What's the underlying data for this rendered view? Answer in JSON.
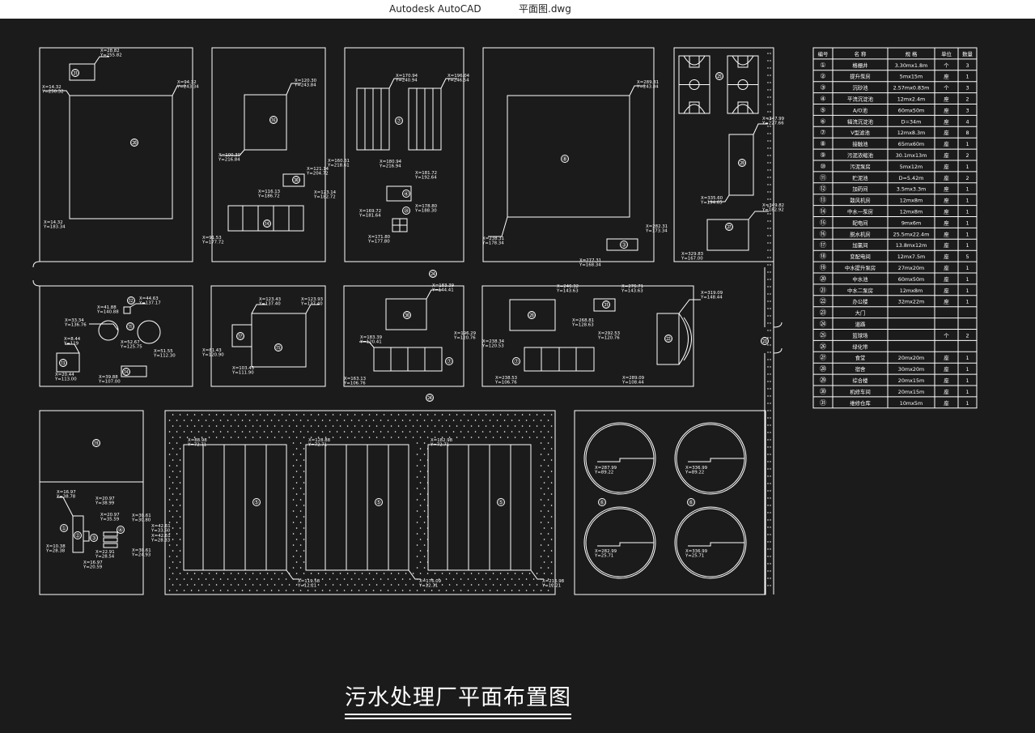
{
  "window": {
    "app_name": "Autodesk AutoCAD",
    "file_name": "平面图.dwg"
  },
  "drawing": {
    "title": "污水处理厂平面布置图",
    "line_color": "#ffffff",
    "background_color": "#1b1b1b",
    "titlebar_color": "#ffffff",
    "structure_labels": [
      "①",
      "②",
      "③",
      "④",
      "⑤",
      "⑥",
      "⑦",
      "⑧",
      "⑨",
      "⑩",
      "⑪",
      "⑫",
      "⑬",
      "⑭",
      "⑮",
      "⑯",
      "⑰",
      "⑱",
      "⑲",
      "⑳",
      "㉑",
      "㉒",
      "㉓",
      "㉔",
      "㉕",
      "㉖",
      "㉗",
      "㉘",
      "㉙",
      "㉚",
      "㉛"
    ]
  },
  "legend_table": {
    "headers": [
      "编号",
      "名 称",
      "规 格",
      "单位",
      "数量"
    ],
    "rows": [
      [
        "①",
        "格栅井",
        "3.30mx1.8m",
        "个",
        "3"
      ],
      [
        "②",
        "提升泵房",
        "5mx15m",
        "座",
        "1"
      ],
      [
        "③",
        "沉砂池",
        "2.57mx0.83m",
        "个",
        "3"
      ],
      [
        "④",
        "平流沉淀池",
        "12mx2.4m",
        "座",
        "2"
      ],
      [
        "⑤",
        "A/O池",
        "60mx50m",
        "座",
        "3"
      ],
      [
        "⑥",
        "辐流沉淀池",
        "D=34m",
        "座",
        "4"
      ],
      [
        "⑦",
        "V型滤池",
        "12mx8.3m",
        "座",
        "8"
      ],
      [
        "⑧",
        "接触池",
        "65mx60m",
        "座",
        "1"
      ],
      [
        "⑨",
        "污泥浓缩池",
        "30.1mx13m",
        "座",
        "2"
      ],
      [
        "⑩",
        "污泥泵房",
        "5mx12m",
        "座",
        "1"
      ],
      [
        "⑪",
        "贮泥池",
        "D=5.42m",
        "座",
        "2"
      ],
      [
        "⑫",
        "加药间",
        "3.5mx3.3m",
        "座",
        "1"
      ],
      [
        "⑬",
        "鼓风机房",
        "12mx8m",
        "座",
        "1"
      ],
      [
        "⑭",
        "中水一泵房",
        "12mx8m",
        "座",
        "1"
      ],
      [
        "⑮",
        "配电间",
        "9mx6m",
        "座",
        "1"
      ],
      [
        "⑯",
        "脱水机房",
        "25.5mx22.4m",
        "座",
        "1"
      ],
      [
        "⑰",
        "加氯间",
        "13.8mx12m",
        "座",
        "1"
      ],
      [
        "⑱",
        "变配电间",
        "12mx7.5m",
        "座",
        "5"
      ],
      [
        "⑲",
        "中水提升泵房",
        "27mx20m",
        "座",
        "1"
      ],
      [
        "⑳",
        "中水池",
        "60mx50m",
        "座",
        "1"
      ],
      [
        "㉑",
        "中水二泵房",
        "12mx8m",
        "座",
        "1"
      ],
      [
        "㉒",
        "办公楼",
        "32mx22m",
        "座",
        "1"
      ],
      [
        "㉓",
        "大门",
        "",
        "",
        ""
      ],
      [
        "㉔",
        "道路",
        "",
        "",
        ""
      ],
      [
        "㉕",
        "篮球场",
        "",
        "个",
        "2"
      ],
      [
        "㉖",
        "绿化带",
        "",
        "",
        ""
      ],
      [
        "㉗",
        "食堂",
        "20mx20m",
        "座",
        "1"
      ],
      [
        "㉘",
        "宿舍",
        "30mx20m",
        "座",
        "1"
      ],
      [
        "㉙",
        "综合楼",
        "20mx15m",
        "座",
        "1"
      ],
      [
        "㉚",
        "机修车间",
        "20mx15m",
        "座",
        "1"
      ],
      [
        "㉛",
        "维修仓库",
        "10mx5m",
        "座",
        "1"
      ]
    ]
  },
  "coordinate_labels": [
    {
      "x": "X=28.82",
      "y": "Y=255.82"
    },
    {
      "x": "X=14.32",
      "y": "Y=250.32"
    },
    {
      "x": "X=94.32",
      "y": "Y=243.34"
    },
    {
      "x": "X=14.32",
      "y": "Y=183.34"
    },
    {
      "x": "X=120.30",
      "y": "Y=243.84"
    },
    {
      "x": "X=100.30",
      "y": "Y=216.84"
    },
    {
      "x": "X=121.14",
      "y": "Y=204.72"
    },
    {
      "x": "X=116.13",
      "y": "Y=186.72"
    },
    {
      "x": "X=123.14",
      "y": "Y=182.72"
    },
    {
      "x": "X=91.53",
      "y": "Y=177.72"
    },
    {
      "x": "X=170.94",
      "y": "Y=240.94"
    },
    {
      "x": "X=196.04",
      "y": "Y=246.54"
    },
    {
      "x": "X=160.61",
      "y": "Y=218.61"
    },
    {
      "x": "X=180.94",
      "y": "Y=216.94"
    },
    {
      "x": "X=181.72",
      "y": "Y=192.64"
    },
    {
      "x": "X=169.72",
      "y": "Y=181.64"
    },
    {
      "x": "X=178.80",
      "y": "Y=188.30"
    },
    {
      "x": "X=171.80",
      "y": "Y=177.80"
    },
    {
      "x": "X=289.31",
      "y": "Y=243.84"
    },
    {
      "x": "X=238.31",
      "y": "Y=178.34"
    },
    {
      "x": "X=282.31",
      "y": "Y=173.34"
    },
    {
      "x": "X=277.31",
      "y": "Y=168.34"
    },
    {
      "x": "X=347.99",
      "y": "Y=227.66"
    },
    {
      "x": "X=335.60",
      "y": "Y=194.65"
    },
    {
      "x": "X=349.82",
      "y": "Y=182.92"
    },
    {
      "x": "X=329.83",
      "y": "Y=167.00"
    },
    {
      "x": "X=44.63",
      "y": "Y=137.17"
    },
    {
      "x": "X=41.88",
      "y": "Y=140.88"
    },
    {
      "x": "X=33.34",
      "y": "Y=136.76"
    },
    {
      "x": "X=8.44",
      "y": "Y=119"
    },
    {
      "x": "X=52.67",
      "y": "Y=125.75"
    },
    {
      "x": "X=51.55",
      "y": "Y=112.30"
    },
    {
      "x": "X=20.44",
      "y": "Y=113.00"
    },
    {
      "x": "X=39.88",
      "y": "Y=107.00"
    },
    {
      "x": "X=123.43",
      "y": "Y=137.40"
    },
    {
      "x": "X=123.93",
      "y": "Y=137.40"
    },
    {
      "x": "X=81.43",
      "y": "Y=120.90"
    },
    {
      "x": "X=103.43",
      "y": "Y=111.90"
    },
    {
      "x": "X=183.39",
      "y": "Y=144.41"
    },
    {
      "x": "X=183.39",
      "y": "Y=120.41"
    },
    {
      "x": "X=196.29",
      "y": "Y=120.76"
    },
    {
      "x": "X=163.13",
      "y": "Y=106.76"
    },
    {
      "x": "X=246.32",
      "y": "Y=143.63"
    },
    {
      "x": "X=276.71",
      "y": "Y=143.63"
    },
    {
      "x": "X=268.81",
      "y": "Y=128.63"
    },
    {
      "x": "X=292.53",
      "y": "Y=120.76"
    },
    {
      "x": "X=238.34",
      "y": "Y=120.53"
    },
    {
      "x": "X=238.53",
      "y": "Y=106.76"
    },
    {
      "x": "X=289.09",
      "y": "Y=108.44"
    },
    {
      "x": "X=319.09",
      "y": "Y=148.44"
    },
    {
      "x": "X=88.98",
      "y": "Y=72.71"
    },
    {
      "x": "X=128.88",
      "y": "Y=72.71"
    },
    {
      "x": "X=182.98",
      "y": "Y=72.71"
    },
    {
      "x": "X=119.58",
      "y": "Y=12.21"
    },
    {
      "x": "X=176.09",
      "y": "Y=12.31"
    },
    {
      "x": "X=216.98",
      "y": "Y=12.21"
    },
    {
      "x": "X=287.99",
      "y": "Y=89.22"
    },
    {
      "x": "X=336.99",
      "y": "Y=89.22"
    },
    {
      "x": "X=282.99",
      "y": "Y=25.71"
    },
    {
      "x": "X=336.99",
      "y": "Y=25.71"
    },
    {
      "x": "X=16.97",
      "y": "Y=38.78"
    },
    {
      "x": "X=20.97",
      "y": "Y=38.99"
    },
    {
      "x": "X=20.97",
      "y": "Y=35.59"
    },
    {
      "x": "X=30.61",
      "y": "Y=30.80"
    },
    {
      "x": "X=42.61",
      "y": "Y=33.60"
    },
    {
      "x": "X=42.61",
      "y": "Y=28.33"
    },
    {
      "x": "X=10.38",
      "y": "Y=28.38"
    },
    {
      "x": "X=22.91",
      "y": "Y=28.54"
    },
    {
      "x": "X=30.61",
      "y": "Y=24.93"
    },
    {
      "x": "X=16.97",
      "y": "Y=20.59"
    }
  ]
}
